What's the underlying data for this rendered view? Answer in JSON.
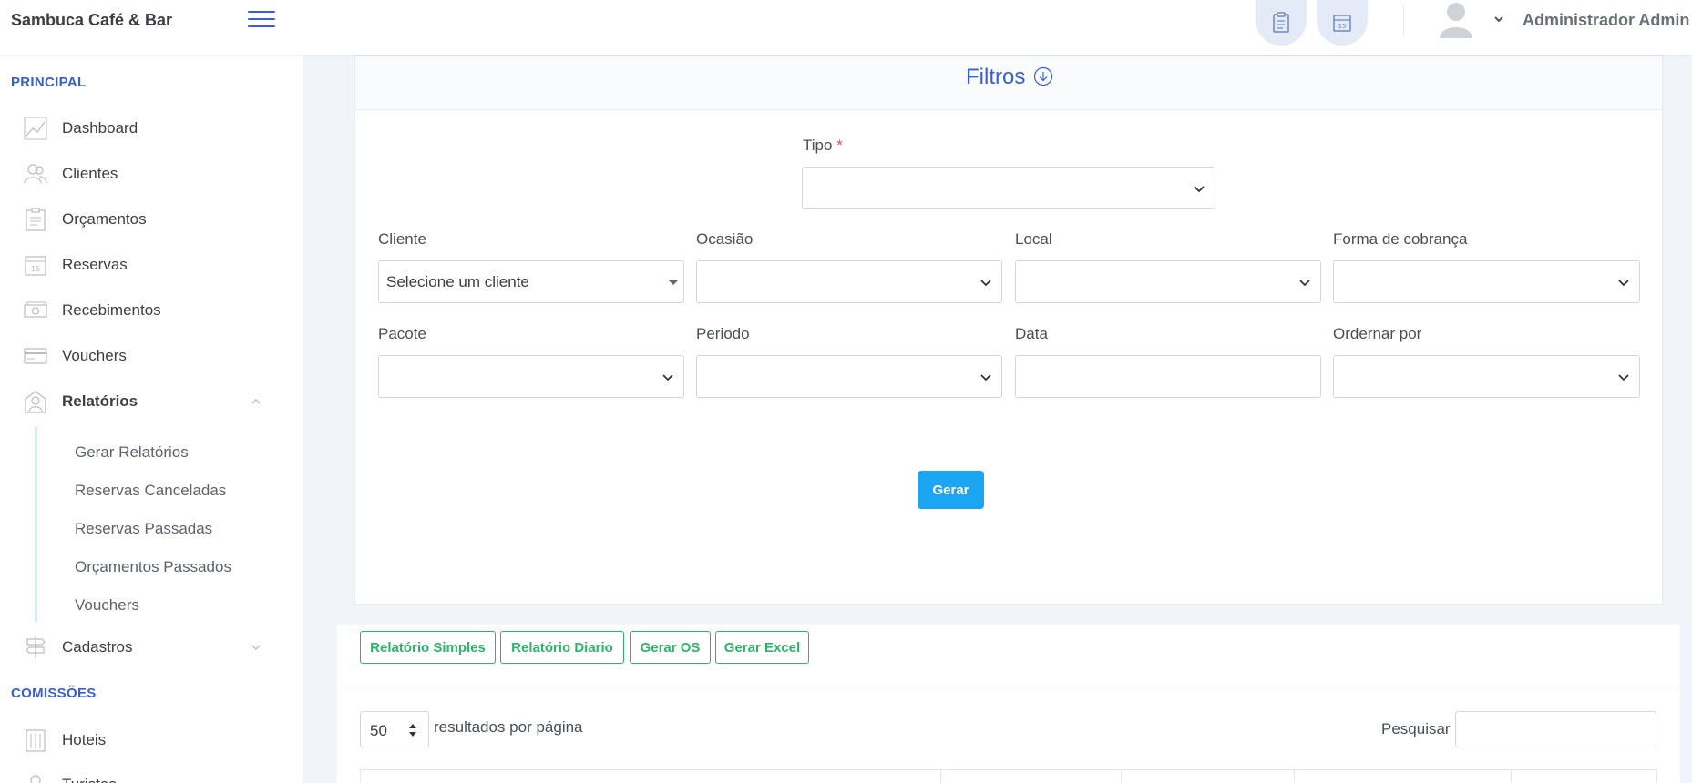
{
  "app": {
    "brand": "Sambuca Café & Bar"
  },
  "topbar": {
    "user_name": "Administrador Admin"
  },
  "sidebar": {
    "section_principal": "PRINCIPAL",
    "items": [
      {
        "label": "Dashboard",
        "icon": "chart-line-icon"
      },
      {
        "label": "Clientes",
        "icon": "users-icon"
      },
      {
        "label": "Orçamentos",
        "icon": "clipboard-icon"
      },
      {
        "label": "Reservas",
        "icon": "calendar-icon"
      },
      {
        "label": "Recebimentos",
        "icon": "money-icon"
      },
      {
        "label": "Vouchers",
        "icon": "card-icon"
      },
      {
        "label": "Relatórios",
        "icon": "report-icon",
        "expanded": true
      },
      {
        "label": "Cadastros",
        "icon": "signpost-icon",
        "expanded": false
      }
    ],
    "subitems": [
      "Gerar Relatórios",
      "Reservas Canceladas",
      "Reservas Passadas",
      "Orçamentos Passados",
      "Vouchers"
    ],
    "section_comissoes": "COMISSÕES",
    "comissoes_items": [
      {
        "label": "Hoteis",
        "icon": "building-icon"
      },
      {
        "label": "Turistas",
        "icon": "person-icon"
      }
    ]
  },
  "filters": {
    "title": "Filtros",
    "tipo_label": "Tipo",
    "required_mark": "*",
    "cliente_label": "Cliente",
    "cliente_value": "Selecione um cliente",
    "ocasiao_label": "Ocasião",
    "local_label": "Local",
    "forma_label": "Forma de cobrança",
    "pacote_label": "Pacote",
    "periodo_label": "Periodo",
    "data_label": "Data",
    "ordenar_label": "Ordernar por",
    "submit_label": "Gerar"
  },
  "results": {
    "buttons": [
      "Relatório Simples",
      "Relatório Diario",
      "Gerar OS",
      "Gerar Excel"
    ],
    "per_page_value": "50",
    "per_page_label": "resultados por página",
    "search_label": "Pesquisar"
  },
  "colors": {
    "accent": "#3a5fcd",
    "primary_button": "#1aa6f2",
    "success_outline": "#2fb36b",
    "required": "#e5534b"
  }
}
